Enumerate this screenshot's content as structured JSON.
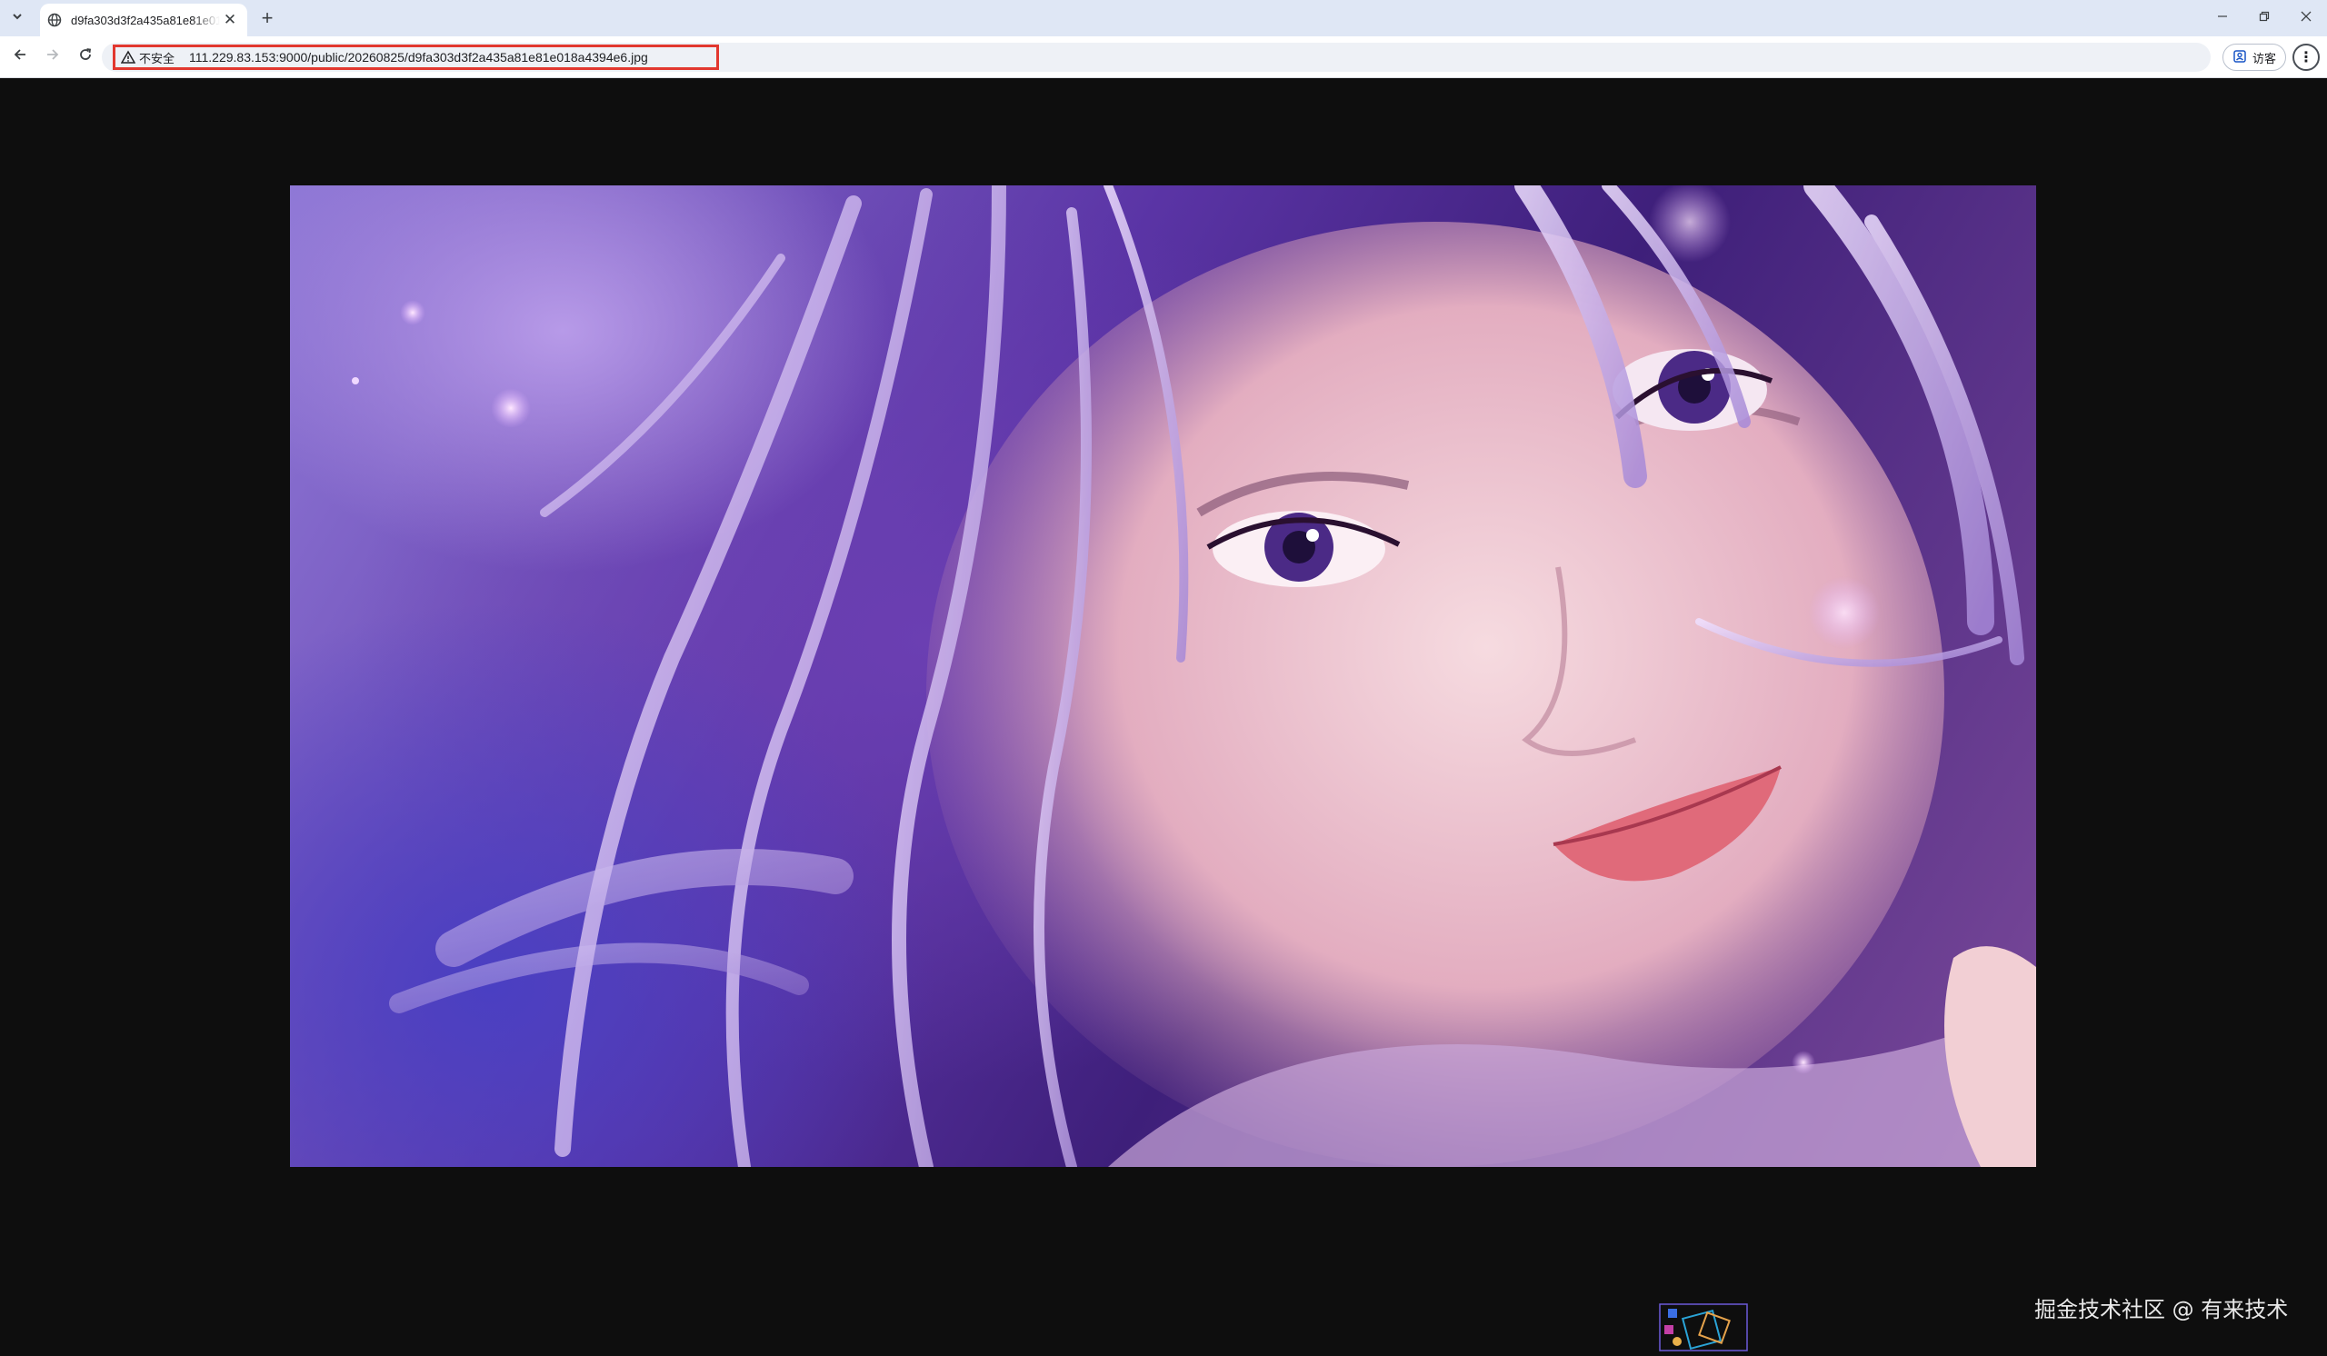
{
  "tab": {
    "title": "d9fa303d3f2a435a81e81e018a4394e6.jpg",
    "favicon": "globe-icon"
  },
  "window_controls": [
    "minimize-icon",
    "restore-icon",
    "close-icon"
  ],
  "toolbar": {
    "security_label": "不安全",
    "url": "111.229.83.153:9000/public/20260825/d9fa303d3f2a435a81e81e018a4394e6.jpg",
    "guest_label": "访客",
    "url_highlight_color": "#e2382f"
  },
  "viewer": {
    "background": "#0e0e0e",
    "image_description_icon": "photo-image",
    "watermark": "掘金技术社区 @ 有来技术"
  }
}
